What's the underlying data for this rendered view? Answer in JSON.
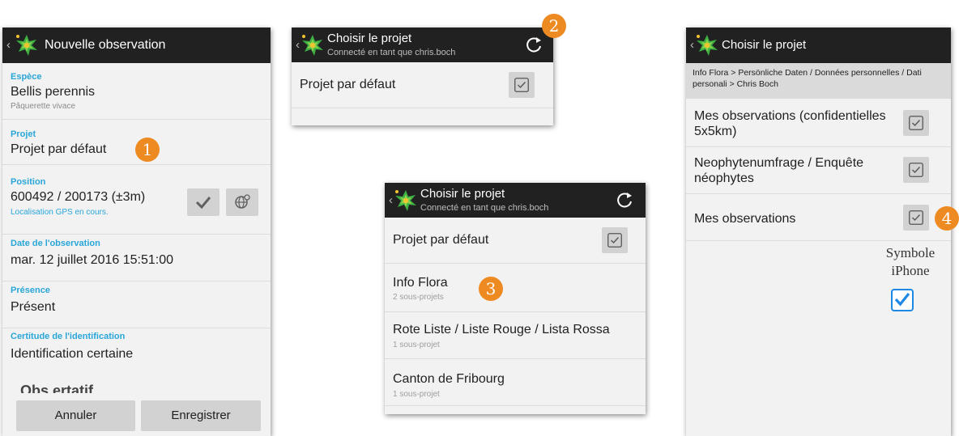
{
  "screen1": {
    "title": "Nouvelle observation",
    "fields": {
      "espece": {
        "label": "Espèce",
        "value": "Bellis perennis",
        "hint": "Pâquerette vivace"
      },
      "projet": {
        "label": "Projet",
        "value": "Projet par défaut"
      },
      "position": {
        "label": "Position",
        "value": "600492 / 200173 (±3m)",
        "hint": "Localisation GPS en cours."
      },
      "date": {
        "label": "Date de l'observation",
        "value": "mar. 12 juillet 2016 15:51:00"
      },
      "presence": {
        "label": "Présence",
        "value": "Présent"
      },
      "certitude": {
        "label": "Certitude de l'identification",
        "value": "Identification certaine"
      }
    },
    "cut_text": "Obs                       ertatif",
    "buttons": {
      "cancel": "Annuler",
      "save": "Enregistrer"
    },
    "badge": "1"
  },
  "screen2": {
    "title": "Choisir le projet",
    "subtitle": "Connecté en tant que chris.boch",
    "items": [
      {
        "title": "Projet par défaut"
      }
    ],
    "badge": "2"
  },
  "screen3": {
    "title": "Choisir le projet",
    "subtitle": "Connecté en tant que chris.boch",
    "items": [
      {
        "title": "Projet par défaut"
      },
      {
        "title": "Info Flora",
        "sub": "2 sous-projets"
      },
      {
        "title": "Rote Liste / Liste Rouge / Lista Rossa",
        "sub": "1 sous-projet"
      },
      {
        "title": "Canton de Fribourg",
        "sub": "1 sous-projet"
      }
    ],
    "badge": "3"
  },
  "screen4": {
    "title": "Choisir le projet",
    "breadcrumb": "Info Flora > Persönliche Daten / Données personnelles / Dati personali > Chris Boch",
    "items": [
      {
        "title": "Mes observations (confidentielles 5x5km)"
      },
      {
        "title": "Neophytenumfrage / Enquête néophytes"
      },
      {
        "title": "Mes observations"
      }
    ],
    "badge": "4",
    "note": "Symbole iPhone"
  },
  "icons": {
    "back": "chevron-left-icon",
    "logo": "info-flora-logo-icon",
    "refresh": "refresh-icon",
    "check": "check-icon",
    "checkbox": "checkbox-icon",
    "gps": "gps-globe-icon"
  },
  "colors": {
    "header": "#212121",
    "label_blue": "#29a6d9",
    "badge_orange": "#ee8a22",
    "logo_green": "#3cb043",
    "iphone_check": "#1e88e5"
  }
}
